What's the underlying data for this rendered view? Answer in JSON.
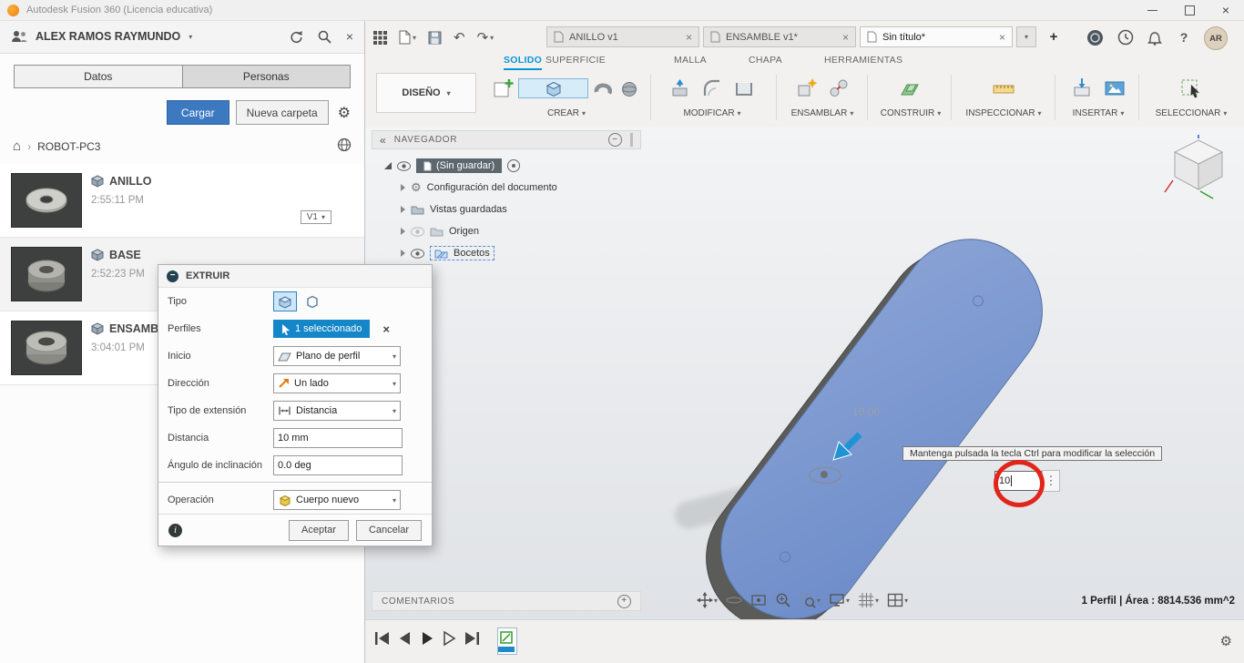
{
  "icons": {
    "chevron_down": "▾",
    "close": "×",
    "home": "⌂",
    "breadcrumb_sep": "›",
    "gear": "⚙",
    "plus": "+",
    "undo": "↶",
    "redo": "↷",
    "dots_vertical": "⋮",
    "collapse": "«",
    "minus": "−",
    "info": "i",
    "help": "?"
  },
  "titlebar": {
    "title": "Autodesk Fusion 360 (Licencia educativa)"
  },
  "data_panel": {
    "user": "ALEX RAMOS RAYMUNDO",
    "tabs": [
      {
        "label": "Datos"
      },
      {
        "label": "Personas"
      }
    ],
    "upload": "Cargar",
    "new_folder": "Nueva carpeta",
    "breadcrumb": "ROBOT-PC3",
    "items": [
      {
        "name": "ANILLO",
        "time": "2:55:11 PM",
        "version": "V1"
      },
      {
        "name": "BASE",
        "time": "2:52:23 PM"
      },
      {
        "name": "ENSAMBLE",
        "time": "3:04:01 PM"
      }
    ]
  },
  "doc_tabs": [
    {
      "label": "ANILLO v1"
    },
    {
      "label": "ENSAMBLE v1*"
    },
    {
      "label": "Sin título*"
    }
  ],
  "header_right": {
    "avatar": "AR"
  },
  "ribbon": {
    "design": "DISEÑO",
    "tabs": [
      {
        "label": "SOLIDO"
      },
      {
        "label": "SUPERFICIE"
      },
      {
        "label": "MALLA"
      },
      {
        "label": "CHAPA"
      },
      {
        "label": "HERRAMIENTAS"
      }
    ],
    "groups": [
      {
        "label": "CREAR"
      },
      {
        "label": "MODIFICAR"
      },
      {
        "label": "ENSAMBLAR"
      },
      {
        "label": "CONSTRUIR"
      },
      {
        "label": "INSPECCIONAR"
      },
      {
        "label": "INSERTAR"
      },
      {
        "label": "SELECCIONAR"
      }
    ]
  },
  "navigator": {
    "title": "NAVEGADOR",
    "root": "(Sin guardar)",
    "nodes": [
      {
        "label": "Configuración del documento"
      },
      {
        "label": "Vistas guardadas"
      },
      {
        "label": "Origen"
      },
      {
        "label": "Bocetos"
      }
    ]
  },
  "dialog": {
    "title": "EXTRUIR",
    "tipo_label": "Tipo",
    "perfiles_label": "Perfiles",
    "perfiles_value": "1 seleccionado",
    "inicio_label": "Inicio",
    "inicio_value": "Plano de perfil",
    "direccion_label": "Dirección",
    "direccion_value": "Un lado",
    "extension_label": "Tipo de extensión",
    "extension_value": "Distancia",
    "distancia_label": "Distancia",
    "distancia_value": "10 mm",
    "angulo_label": "Ángulo de inclinación",
    "angulo_value": "0.0 deg",
    "operacion_label": "Operación",
    "operacion_value": "Cuerpo nuevo",
    "accept": "Aceptar",
    "cancel": "Cancelar"
  },
  "canvas": {
    "dimension": "10.00",
    "tooltip": "Mantenga pulsada la tecla Ctrl para modificar la selección",
    "distance_value": "10",
    "status": "1 Perfil | Área : 8814.536 mm^2"
  },
  "comments": {
    "title": "COMENTARIOS"
  }
}
